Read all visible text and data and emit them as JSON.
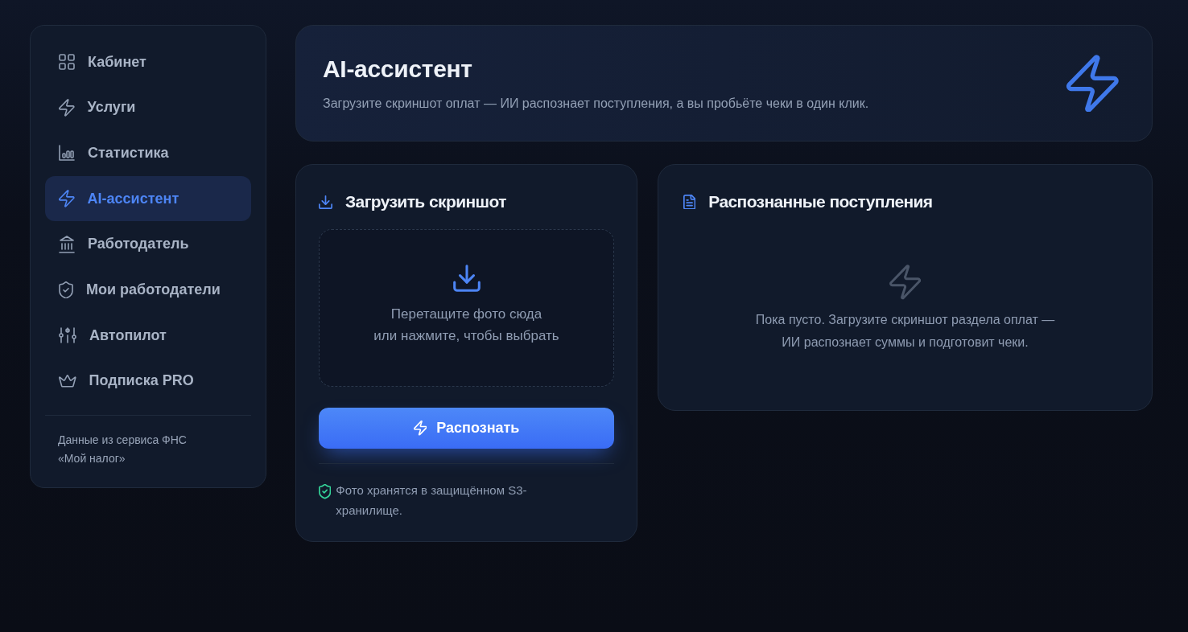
{
  "sidebar": {
    "items": [
      {
        "label": "Кабинет",
        "selected": false
      },
      {
        "label": "Услуги",
        "selected": false
      },
      {
        "label": "Статистика",
        "selected": false
      },
      {
        "label": "AI-ассистент",
        "selected": true
      },
      {
        "label": "Работодатель",
        "selected": false
      },
      {
        "label": "Мои работодатели",
        "selected": false
      },
      {
        "label": "Автопилот",
        "selected": false
      },
      {
        "label": "Подписка PRO",
        "selected": false
      }
    ],
    "footer_lines": [
      "Данные из сервиса ФНС",
      "«Мой налог»"
    ]
  },
  "header": {
    "title": "AI-ассистент",
    "subtitle": "Загрузите скриншот оплат — ИИ распознает поступления, а вы пробьёте чеки в один клик."
  },
  "upload": {
    "title": "Загрузить скриншот",
    "dropzone": {
      "hint_lines": [
        "Перетащите фото сюда",
        "или нажмите, чтобы выбрать"
      ]
    },
    "button": "Распознать",
    "note": "Фото хранятся в защищённом S3-хранилище."
  },
  "results": {
    "title": "Распознанные поступления",
    "empty_lines": [
      "Пока пусто. Загрузите скриншот раздела оплат —",
      "ИИ распознает суммы и подготовит чеки."
    ]
  }
}
